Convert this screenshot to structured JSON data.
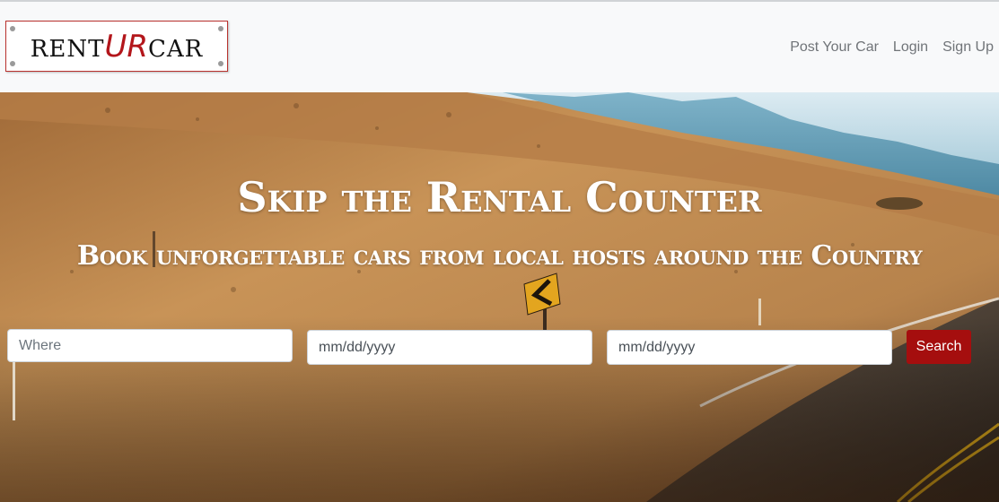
{
  "navbar": {
    "logo": {
      "part1": "RENT",
      "part2": "UR",
      "part3": "CAR"
    },
    "links": [
      {
        "label": "Post Your Car"
      },
      {
        "label": "Login"
      },
      {
        "label": "Sign Up"
      }
    ]
  },
  "hero": {
    "title": "Skip the Rental Counter",
    "subtitle": "Book unforgettable cars from local hosts around the Country"
  },
  "search": {
    "where_placeholder": "Where",
    "start_date_value": "mm/dd/yyyy",
    "end_date_value": "mm/dd/yyyy",
    "button_label": "Search"
  },
  "colors": {
    "accent_red": "#a50e0e",
    "logo_red": "#b3161b",
    "nav_text": "#707478",
    "navbar_bg": "#f8f9fa"
  }
}
